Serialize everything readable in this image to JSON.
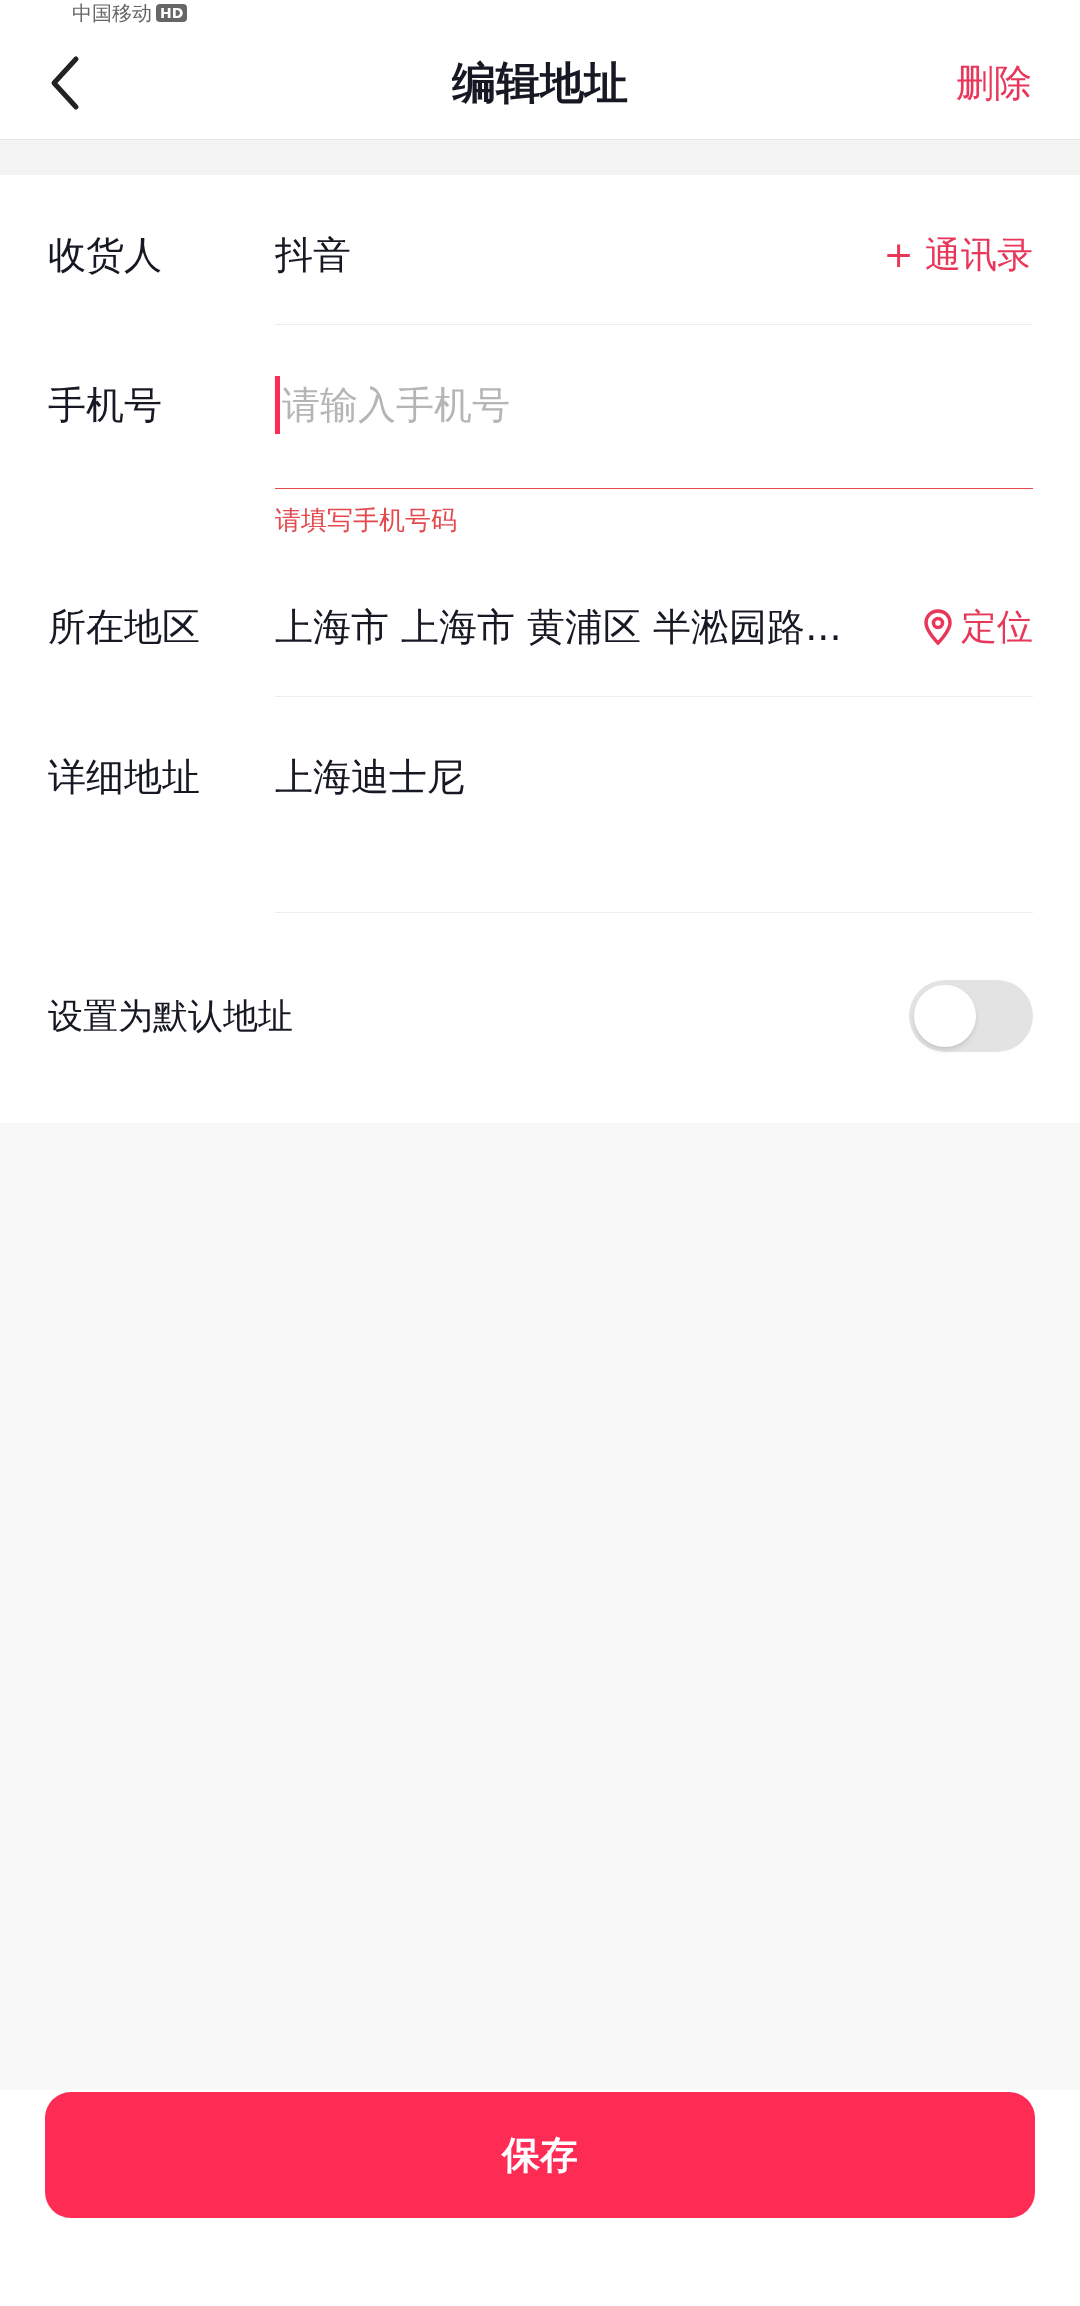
{
  "status_bar": {
    "carrier": "中国移动",
    "badge": "HD"
  },
  "nav": {
    "title": "编辑地址",
    "action": "删除"
  },
  "fields": [
    {
      "kind": "text",
      "label": "收货人",
      "value": "抖音",
      "link": "+ 通讯录"
    },
    {
      "kind": "input",
      "label": "手机号",
      "placeholder": "请输入手机号",
      "error": "请填写手机号码",
      "focused": true
    },
    {
      "kind": "location",
      "label": "所在地区",
      "value": "上海市 上海市 黄浦区 半淞园路...",
      "link": "定位"
    },
    {
      "kind": "multiline",
      "label": "详细地址",
      "value": "上海迪士尼"
    }
  ],
  "default_toggle": {
    "label": "设置为默认地址",
    "on": false
  },
  "save_button": {
    "label": "保存"
  }
}
